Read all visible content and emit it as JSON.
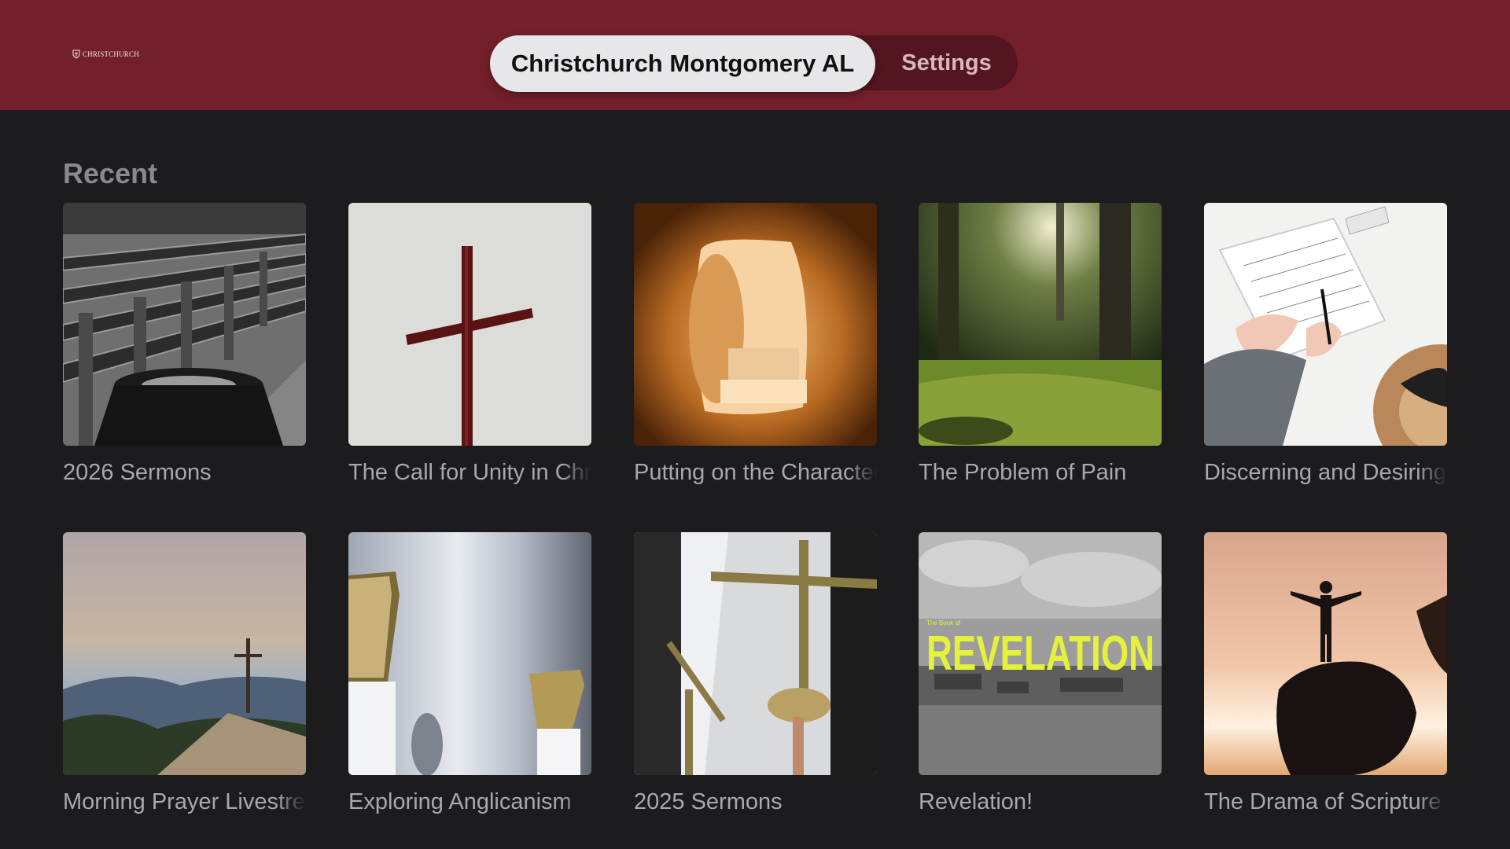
{
  "header": {
    "logo_text": "CHRISTCHURCH",
    "tabs": [
      {
        "label": "Christchurch Montgomery AL",
        "selected": true
      },
      {
        "label": "Settings",
        "selected": false
      }
    ]
  },
  "recent": {
    "title": "Recent",
    "items": [
      {
        "label": "2026 Sermons",
        "image": "church-pews-baptismal-font"
      },
      {
        "label": "The Call for Unity in Christ",
        "image": "wooden-cross"
      },
      {
        "label": "Putting on the Character of Christ",
        "image": "empty-tomb"
      },
      {
        "label": "The Problem of Pain",
        "image": "forest-path"
      },
      {
        "label": "Discerning and Desiring",
        "image": "planner-desk"
      },
      {
        "label": "Morning Prayer Livestream",
        "image": "mountain-summit-cross"
      },
      {
        "label": "Exploring Anglicanism",
        "image": "brass-candle-holders"
      },
      {
        "label": "2025 Sermons",
        "image": "processional-crosses"
      },
      {
        "label": "Revelation!",
        "image": "revelation-cover"
      },
      {
        "label": "The Drama of Scripture",
        "image": "silhouette-on-rock"
      }
    ],
    "revelation_cover": {
      "small": "The Book of",
      "big": "REVELATION"
    }
  },
  "colors": {
    "header_bg": "#74202c",
    "body_bg": "#1c1c1e",
    "revelation_accent": "#e6f23a"
  }
}
